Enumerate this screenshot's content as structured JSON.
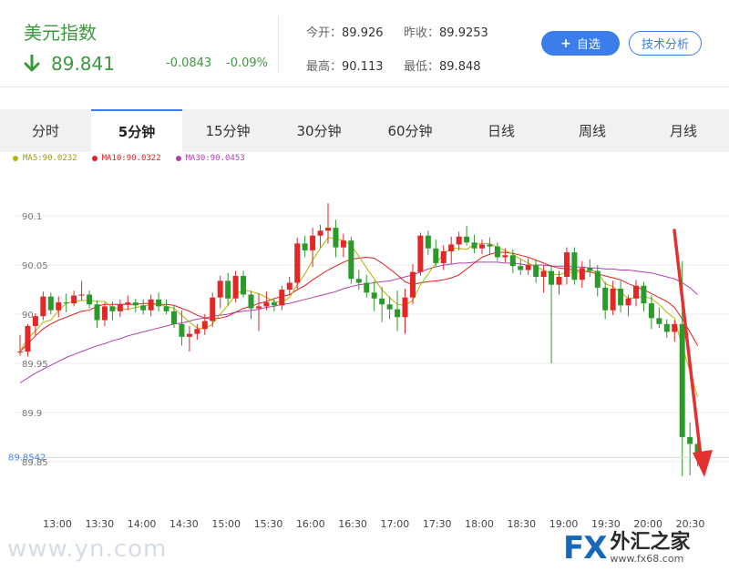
{
  "header": {
    "name": "美元指数",
    "price": "89.841",
    "change": "-0.0843",
    "change_pct": "-0.09%",
    "open_label": "今开：",
    "open": "89.926",
    "prev_close_label": "昨收：",
    "prev_close": "89.9253",
    "high_label": "最高：",
    "high": "90.113",
    "low_label": "最低：",
    "low": "89.848",
    "follow_button": "自选",
    "tech_button": "技术分析"
  },
  "tabs": [
    "分时",
    "5分钟",
    "15分钟",
    "30分钟",
    "60分钟",
    "日线",
    "周线",
    "月线"
  ],
  "active_tab": 1,
  "legend": [
    {
      "label": "MA5:90.0232",
      "color": "#b5b500"
    },
    {
      "label": "MA10:90.0322",
      "color": "#e02020"
    },
    {
      "label": "MA30:90.0453",
      "color": "#b040b0"
    }
  ],
  "colors": {
    "up": "#e32626",
    "down": "#2a9a2a",
    "price_line": "#4a86e8",
    "arrow": "#e43030"
  },
  "watermark": "www.yn.com",
  "logo": {
    "fx": "FX",
    "cn": "外汇之家",
    "url": "www.fx68.com"
  },
  "chart_data": {
    "type": "candlestick",
    "ylim": [
      89.81,
      90.14
    ],
    "yticks": [
      "90.1",
      "90.05",
      "90",
      "89.95",
      "89.9",
      "89.85"
    ],
    "ytick_values": [
      90.1,
      90.05,
      90.0,
      89.95,
      89.9,
      89.85
    ],
    "current_price_label": "89.8542",
    "current_price": 89.8542,
    "xticks": [
      "13:00",
      "13:30",
      "14:00",
      "14:30",
      "15:00",
      "15:30",
      "16:00",
      "16:30",
      "17:00",
      "17:30",
      "18:00",
      "18:30",
      "19:00",
      "19:30",
      "20:00",
      "20:30"
    ],
    "grid": true,
    "candles": [
      [
        89.962,
        89.979,
        89.958,
        89.962
      ],
      [
        89.962,
        89.99,
        89.957,
        89.988
      ],
      [
        89.988,
        90.001,
        89.978,
        89.998
      ],
      [
        89.998,
        90.023,
        89.994,
        90.018
      ],
      [
        90.018,
        90.022,
        90.0,
        90.004
      ],
      [
        90.004,
        90.018,
        89.997,
        90.012
      ],
      [
        90.012,
        90.021,
        90.002,
        90.011
      ],
      [
        90.011,
        90.024,
        90.008,
        90.019
      ],
      [
        90.019,
        90.034,
        90.014,
        90.02
      ],
      [
        90.02,
        90.024,
        90.006,
        90.01
      ],
      [
        90.01,
        90.014,
        89.986,
        89.994
      ],
      [
        89.994,
        90.012,
        89.988,
        90.008
      ],
      [
        90.008,
        90.013,
        89.994,
        90.003
      ],
      [
        90.003,
        90.015,
        89.997,
        90.01
      ],
      [
        90.01,
        90.019,
        90.004,
        90.012
      ],
      [
        90.012,
        90.016,
        90.002,
        90.009
      ],
      [
        90.009,
        90.015,
        90.0,
        90.004
      ],
      [
        90.004,
        90.02,
        89.998,
        90.015
      ],
      [
        90.015,
        90.022,
        90.003,
        90.008
      ],
      [
        90.008,
        90.015,
        90.0,
        90.003
      ],
      [
        90.003,
        90.009,
        89.986,
        89.99
      ],
      [
        89.99,
        90.004,
        89.968,
        89.977
      ],
      [
        89.977,
        89.988,
        89.962,
        89.98
      ],
      [
        89.98,
        89.99,
        89.974,
        89.985
      ],
      [
        89.985,
        90.0,
        89.979,
        89.993
      ],
      [
        89.993,
        90.022,
        89.987,
        90.017
      ],
      [
        90.017,
        90.039,
        90.006,
        90.034
      ],
      [
        90.034,
        90.042,
        90.009,
        90.016
      ],
      [
        90.016,
        90.044,
        90.012,
        90.039
      ],
      [
        90.039,
        90.044,
        90.017,
        90.02
      ],
      [
        90.02,
        90.024,
        89.995,
        90.006
      ],
      [
        90.006,
        90.021,
        89.983,
        90.008
      ],
      [
        90.008,
        90.023,
        90.004,
        90.012
      ],
      [
        90.012,
        90.016,
        90.003,
        90.009
      ],
      [
        90.009,
        90.029,
        90.004,
        90.025
      ],
      [
        90.025,
        90.038,
        90.019,
        90.032
      ],
      [
        90.032,
        90.078,
        90.026,
        90.072
      ],
      [
        90.072,
        90.08,
        90.058,
        90.065
      ],
      [
        90.065,
        90.088,
        90.048,
        90.08
      ],
      [
        90.08,
        90.091,
        90.068,
        90.085
      ],
      [
        90.085,
        90.113,
        90.072,
        90.088
      ],
      [
        90.088,
        90.096,
        90.058,
        90.068
      ],
      [
        90.068,
        90.082,
        90.058,
        90.075
      ],
      [
        90.075,
        90.079,
        90.031,
        90.036
      ],
      [
        90.036,
        90.045,
        90.025,
        90.032
      ],
      [
        90.032,
        90.04,
        90.017,
        90.022
      ],
      [
        90.022,
        90.034,
        90.003,
        90.016
      ],
      [
        90.016,
        90.028,
        89.992,
        90.01
      ],
      [
        90.01,
        90.018,
        89.995,
        90.005
      ],
      [
        90.005,
        90.024,
        89.983,
        89.997
      ],
      [
        89.997,
        90.026,
        89.98,
        90.017
      ],
      [
        90.017,
        90.051,
        90.01,
        90.043
      ],
      [
        90.043,
        90.083,
        90.039,
        90.08
      ],
      [
        90.08,
        90.085,
        90.06,
        90.067
      ],
      [
        90.067,
        90.076,
        90.048,
        90.052
      ],
      [
        90.052,
        90.07,
        90.045,
        90.064
      ],
      [
        90.064,
        90.079,
        90.051,
        90.071
      ],
      [
        90.071,
        90.084,
        90.065,
        90.079
      ],
      [
        90.079,
        90.09,
        90.07,
        90.073
      ],
      [
        90.073,
        90.081,
        90.062,
        90.067
      ],
      [
        90.067,
        90.076,
        90.061,
        90.071
      ],
      [
        90.071,
        90.078,
        90.06,
        90.069
      ],
      [
        90.069,
        90.073,
        90.054,
        90.058
      ],
      [
        90.058,
        90.067,
        90.053,
        90.06
      ],
      [
        90.06,
        90.066,
        90.042,
        90.049
      ],
      [
        90.049,
        90.056,
        90.04,
        90.045
      ],
      [
        90.045,
        90.057,
        90.04,
        90.05
      ],
      [
        90.05,
        90.056,
        90.032,
        90.038
      ],
      [
        90.038,
        90.05,
        90.022,
        90.044
      ],
      [
        90.044,
        90.05,
        89.95,
        90.03
      ],
      [
        90.03,
        90.044,
        90.02,
        90.038
      ],
      [
        90.038,
        90.068,
        90.03,
        90.063
      ],
      [
        90.063,
        90.068,
        90.03,
        90.035
      ],
      [
        90.035,
        90.054,
        90.027,
        90.047
      ],
      [
        90.047,
        90.056,
        90.038,
        90.044
      ],
      [
        90.044,
        90.05,
        90.018,
        90.027
      ],
      [
        90.027,
        90.033,
        89.995,
        90.004
      ],
      [
        90.004,
        90.034,
        89.999,
        90.026
      ],
      [
        90.026,
        90.034,
        90.002,
        90.009
      ],
      [
        90.009,
        90.02,
        89.998,
        90.016
      ],
      [
        90.016,
        90.035,
        90.008,
        90.029
      ],
      [
        90.029,
        90.033,
        90.003,
        90.011
      ],
      [
        90.011,
        90.019,
        89.985,
        89.996
      ],
      [
        89.996,
        90.007,
        89.986,
        89.99
      ],
      [
        89.99,
        89.995,
        89.976,
        89.982
      ],
      [
        89.982,
        89.994,
        89.972,
        89.99
      ],
      [
        89.99,
        90.054,
        89.835,
        89.875
      ],
      [
        89.875,
        89.89,
        89.836,
        89.868
      ],
      [
        89.868,
        89.893,
        89.845,
        89.854
      ]
    ],
    "ma5": [
      89.962,
      89.975,
      89.983,
      89.992,
      89.994,
      90.004,
      90.011,
      90.013,
      90.014,
      90.014,
      90.013,
      90.013,
      90.007,
      90.005,
      90.005,
      90.007,
      90.008,
      90.01,
      90.01,
      90.008,
      90.006,
      89.999,
      89.992,
      89.986,
      89.985,
      89.99,
      90.0,
      90.009,
      90.02,
      90.025,
      90.023,
      90.021,
      90.017,
      90.013,
      90.012,
      90.017,
      90.03,
      90.041,
      90.055,
      90.067,
      90.078,
      90.077,
      90.075,
      90.07,
      90.059,
      90.047,
      90.036,
      90.025,
      90.017,
      90.01,
      90.009,
      90.014,
      90.03,
      90.041,
      90.052,
      90.061,
      90.067,
      90.067,
      90.066,
      90.071,
      90.072,
      90.072,
      90.068,
      90.065,
      90.061,
      90.056,
      90.052,
      90.048,
      90.045,
      90.041,
      90.04,
      90.043,
      90.042,
      90.043,
      90.045,
      90.043,
      90.031,
      90.028,
      90.022,
      90.016,
      90.017,
      90.018,
      90.016,
      90.01,
      90.002,
      89.996,
      89.967,
      89.942,
      89.916
    ],
    "ma10": [
      89.962,
      89.97,
      89.978,
      89.985,
      89.99,
      89.994,
      89.997,
      90.0,
      90.003,
      90.004,
      90.008,
      90.01,
      90.01,
      90.01,
      90.01,
      90.01,
      90.011,
      90.011,
      90.01,
      90.01,
      90.009,
      90.006,
      90.003,
      89.999,
      89.996,
      89.995,
      89.996,
      89.998,
      90.002,
      90.006,
      90.008,
      90.011,
      90.013,
      90.016,
      90.018,
      90.02,
      90.025,
      90.029,
      90.035,
      90.04,
      90.045,
      90.049,
      90.053,
      90.056,
      90.057,
      90.058,
      90.057,
      90.052,
      90.046,
      90.04,
      90.033,
      90.03,
      90.032,
      90.033,
      90.034,
      90.035,
      90.037,
      90.04,
      90.046,
      90.052,
      90.058,
      90.061,
      90.063,
      90.063,
      90.062,
      90.06,
      90.058,
      90.055,
      90.052,
      90.049,
      90.047,
      90.046,
      90.045,
      90.044,
      90.043,
      90.041,
      90.039,
      90.037,
      90.035,
      90.031,
      90.028,
      90.025,
      90.021,
      90.017,
      90.013,
      90.007,
      89.995,
      89.982,
      89.968
    ],
    "ma30": [
      89.93,
      89.935,
      89.94,
      89.944,
      89.948,
      89.952,
      89.956,
      89.959,
      89.962,
      89.965,
      89.968,
      89.97,
      89.973,
      89.975,
      89.978,
      89.98,
      89.982,
      89.984,
      89.986,
      89.988,
      89.99,
      89.991,
      89.993,
      89.995,
      89.996,
      89.998,
      89.999,
      90.0,
      90.002,
      90.003,
      90.004,
      90.005,
      90.007,
      90.008,
      90.01,
      90.011,
      90.013,
      90.015,
      90.017,
      90.019,
      90.021,
      90.023,
      90.026,
      90.028,
      90.03,
      90.031,
      90.032,
      90.033,
      90.034,
      90.036,
      90.038,
      90.04,
      90.043,
      90.046,
      90.048,
      90.05,
      90.051,
      90.052,
      90.052,
      90.053,
      90.053,
      90.053,
      90.053,
      90.052,
      90.052,
      90.051,
      90.05,
      90.05,
      90.05,
      90.049,
      90.049,
      90.049,
      90.048,
      90.048,
      90.047,
      90.047,
      90.046,
      90.046,
      90.045,
      90.045,
      90.044,
      90.043,
      90.042,
      90.04,
      90.038,
      90.036,
      90.032,
      90.027,
      90.02
    ]
  }
}
